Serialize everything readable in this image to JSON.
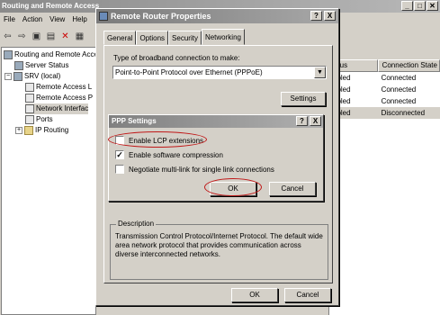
{
  "mmc": {
    "title": "Routing and Remote Access",
    "menu": [
      "File",
      "Action",
      "View",
      "Help"
    ],
    "tree": [
      {
        "label": "Routing and Remote Acce"
      },
      {
        "label": "Server Status"
      },
      {
        "label": "SRV (local)"
      },
      {
        "label": "Remote Access L"
      },
      {
        "label": "Remote Access P"
      },
      {
        "label": "Network Interfac"
      },
      {
        "label": "Ports"
      },
      {
        "label": "IP Routing"
      }
    ],
    "columns": [
      "atus",
      "Connection State"
    ],
    "rows": [
      {
        "status": "abled",
        "state": "Connected"
      },
      {
        "status": "abled",
        "state": "Connected"
      },
      {
        "status": "abled",
        "state": "Connected"
      },
      {
        "status": "abled",
        "state": "Disconnected"
      }
    ]
  },
  "props": {
    "title": "Remote Router Properties",
    "tabs": [
      "General",
      "Options",
      "Security",
      "Networking"
    ],
    "type_label": "Type of broadband connection to make:",
    "type_value": "Point-to-Point Protocol over Ethernet (PPPoE)",
    "settings_label": "Settings",
    "desc_legend": "Description",
    "desc_text": "Transmission Control Protocol/Internet Protocol. The default wide area network protocol that provides communication across diverse interconnected networks.",
    "ok_label": "OK",
    "cancel_label": "Cancel"
  },
  "ppp": {
    "title": "PPP Settings",
    "options": [
      {
        "label": "Enable LCP extensions",
        "checked": false
      },
      {
        "label": "Enable software compression",
        "checked": true
      },
      {
        "label": "Negotiate multi-link for single link connections",
        "checked": false
      }
    ],
    "ok_label": "OK",
    "cancel_label": "Cancel"
  },
  "caption_buttons": {
    "help": "?",
    "close": "X"
  }
}
